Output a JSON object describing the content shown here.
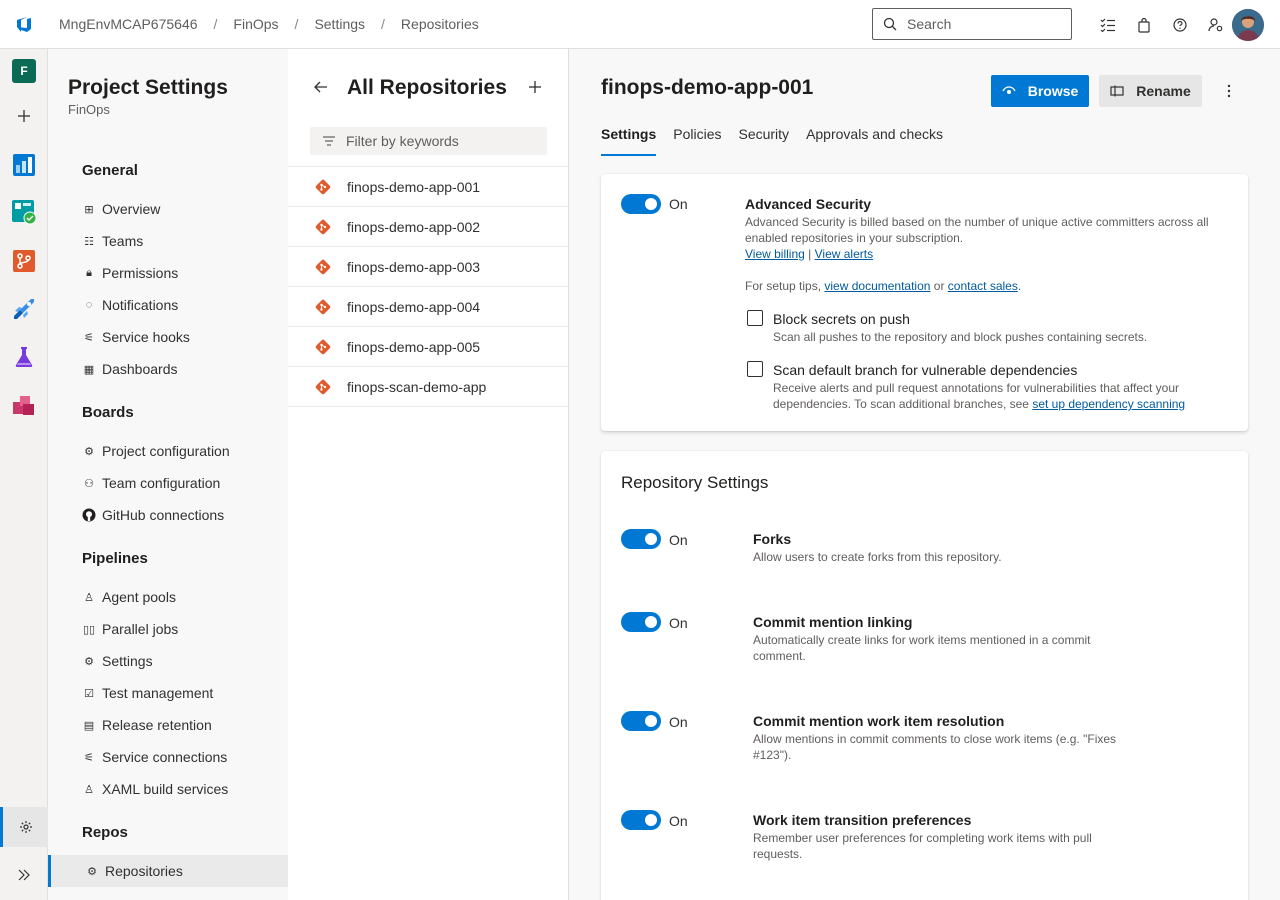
{
  "breadcrumbs": [
    "MngEnvMCAP675646",
    "FinOps",
    "Settings",
    "Repositories"
  ],
  "search": {
    "placeholder": "Search"
  },
  "rail": {
    "project_initial": "F"
  },
  "nav": {
    "title": "Project Settings",
    "subtitle": "FinOps",
    "sections": [
      {
        "label": "General",
        "items": [
          "Overview",
          "Teams",
          "Permissions",
          "Notifications",
          "Service hooks",
          "Dashboards"
        ]
      },
      {
        "label": "Boards",
        "items": [
          "Project configuration",
          "Team configuration",
          "GitHub connections"
        ]
      },
      {
        "label": "Pipelines",
        "items": [
          "Agent pools",
          "Parallel jobs",
          "Settings",
          "Test management",
          "Release retention",
          "Service connections",
          "XAML build services"
        ]
      },
      {
        "label": "Repos",
        "items": [
          "Repositories"
        ]
      }
    ]
  },
  "repos": {
    "title": "All Repositories",
    "filter_placeholder": "Filter by keywords",
    "items": [
      "finops-demo-app-001",
      "finops-demo-app-002",
      "finops-demo-app-003",
      "finops-demo-app-004",
      "finops-demo-app-005",
      "finops-scan-demo-app"
    ]
  },
  "main": {
    "title": "finops-demo-app-001",
    "browse_label": "Browse",
    "rename_label": "Rename",
    "tabs": [
      "Settings",
      "Policies",
      "Security",
      "Approvals and checks"
    ],
    "advanced_security": {
      "toggle_label": "On",
      "title": "Advanced Security",
      "desc": "Advanced Security is billed based on the number of unique active committers across all enabled repositories in your subscription.",
      "view_billing": "View billing",
      "link_sep": "|",
      "view_alerts": "View alerts",
      "setup_prefix": "For setup tips,",
      "view_documentation": "view documentation",
      "or": "or",
      "contact_sales": "contact sales",
      "period": ".",
      "block_secrets_title": "Block secrets on push",
      "block_secrets_desc": "Scan all pushes to the repository and block pushes containing secrets.",
      "scan_title": "Scan default branch for vulnerable dependencies",
      "scan_desc": "Receive alerts and pull request annotations for vulnerabilities that affect your dependencies. To scan additional branches, see",
      "scan_link": "set up dependency scanning"
    },
    "repo_settings": {
      "title": "Repository Settings",
      "items": [
        {
          "toggle": "On",
          "title": "Forks",
          "desc": "Allow users to create forks from this repository."
        },
        {
          "toggle": "On",
          "title": "Commit mention linking",
          "desc": "Automatically create links for work items mentioned in a commit comment."
        },
        {
          "toggle": "On",
          "title": "Commit mention work item resolution",
          "desc": "Allow mentions in commit comments to close work items (e.g. \"Fixes #123\")."
        },
        {
          "toggle": "On",
          "title": "Work item transition preferences",
          "desc": "Remember user preferences for completing work items with pull requests."
        }
      ]
    }
  }
}
